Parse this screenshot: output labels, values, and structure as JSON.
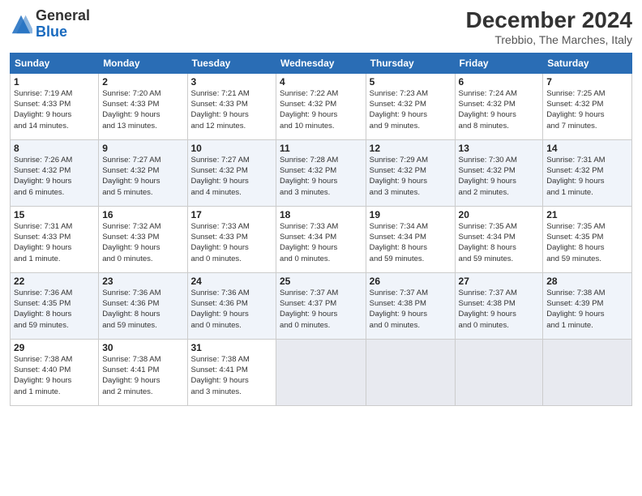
{
  "logo": {
    "general": "General",
    "blue": "Blue"
  },
  "title": "December 2024",
  "location": "Trebbio, The Marches, Italy",
  "headers": [
    "Sunday",
    "Monday",
    "Tuesday",
    "Wednesday",
    "Thursday",
    "Friday",
    "Saturday"
  ],
  "weeks": [
    [
      {
        "day": "1",
        "info": "Sunrise: 7:19 AM\nSunset: 4:33 PM\nDaylight: 9 hours\nand 14 minutes."
      },
      {
        "day": "2",
        "info": "Sunrise: 7:20 AM\nSunset: 4:33 PM\nDaylight: 9 hours\nand 13 minutes."
      },
      {
        "day": "3",
        "info": "Sunrise: 7:21 AM\nSunset: 4:33 PM\nDaylight: 9 hours\nand 12 minutes."
      },
      {
        "day": "4",
        "info": "Sunrise: 7:22 AM\nSunset: 4:32 PM\nDaylight: 9 hours\nand 10 minutes."
      },
      {
        "day": "5",
        "info": "Sunrise: 7:23 AM\nSunset: 4:32 PM\nDaylight: 9 hours\nand 9 minutes."
      },
      {
        "day": "6",
        "info": "Sunrise: 7:24 AM\nSunset: 4:32 PM\nDaylight: 9 hours\nand 8 minutes."
      },
      {
        "day": "7",
        "info": "Sunrise: 7:25 AM\nSunset: 4:32 PM\nDaylight: 9 hours\nand 7 minutes."
      }
    ],
    [
      {
        "day": "8",
        "info": "Sunrise: 7:26 AM\nSunset: 4:32 PM\nDaylight: 9 hours\nand 6 minutes."
      },
      {
        "day": "9",
        "info": "Sunrise: 7:27 AM\nSunset: 4:32 PM\nDaylight: 9 hours\nand 5 minutes."
      },
      {
        "day": "10",
        "info": "Sunrise: 7:27 AM\nSunset: 4:32 PM\nDaylight: 9 hours\nand 4 minutes."
      },
      {
        "day": "11",
        "info": "Sunrise: 7:28 AM\nSunset: 4:32 PM\nDaylight: 9 hours\nand 3 minutes."
      },
      {
        "day": "12",
        "info": "Sunrise: 7:29 AM\nSunset: 4:32 PM\nDaylight: 9 hours\nand 3 minutes."
      },
      {
        "day": "13",
        "info": "Sunrise: 7:30 AM\nSunset: 4:32 PM\nDaylight: 9 hours\nand 2 minutes."
      },
      {
        "day": "14",
        "info": "Sunrise: 7:31 AM\nSunset: 4:32 PM\nDaylight: 9 hours\nand 1 minute."
      }
    ],
    [
      {
        "day": "15",
        "info": "Sunrise: 7:31 AM\nSunset: 4:33 PM\nDaylight: 9 hours\nand 1 minute."
      },
      {
        "day": "16",
        "info": "Sunrise: 7:32 AM\nSunset: 4:33 PM\nDaylight: 9 hours\nand 0 minutes."
      },
      {
        "day": "17",
        "info": "Sunrise: 7:33 AM\nSunset: 4:33 PM\nDaylight: 9 hours\nand 0 minutes."
      },
      {
        "day": "18",
        "info": "Sunrise: 7:33 AM\nSunset: 4:34 PM\nDaylight: 9 hours\nand 0 minutes."
      },
      {
        "day": "19",
        "info": "Sunrise: 7:34 AM\nSunset: 4:34 PM\nDaylight: 8 hours\nand 59 minutes."
      },
      {
        "day": "20",
        "info": "Sunrise: 7:35 AM\nSunset: 4:34 PM\nDaylight: 8 hours\nand 59 minutes."
      },
      {
        "day": "21",
        "info": "Sunrise: 7:35 AM\nSunset: 4:35 PM\nDaylight: 8 hours\nand 59 minutes."
      }
    ],
    [
      {
        "day": "22",
        "info": "Sunrise: 7:36 AM\nSunset: 4:35 PM\nDaylight: 8 hours\nand 59 minutes."
      },
      {
        "day": "23",
        "info": "Sunrise: 7:36 AM\nSunset: 4:36 PM\nDaylight: 8 hours\nand 59 minutes."
      },
      {
        "day": "24",
        "info": "Sunrise: 7:36 AM\nSunset: 4:36 PM\nDaylight: 9 hours\nand 0 minutes."
      },
      {
        "day": "25",
        "info": "Sunrise: 7:37 AM\nSunset: 4:37 PM\nDaylight: 9 hours\nand 0 minutes."
      },
      {
        "day": "26",
        "info": "Sunrise: 7:37 AM\nSunset: 4:38 PM\nDaylight: 9 hours\nand 0 minutes."
      },
      {
        "day": "27",
        "info": "Sunrise: 7:37 AM\nSunset: 4:38 PM\nDaylight: 9 hours\nand 0 minutes."
      },
      {
        "day": "28",
        "info": "Sunrise: 7:38 AM\nSunset: 4:39 PM\nDaylight: 9 hours\nand 1 minute."
      }
    ],
    [
      {
        "day": "29",
        "info": "Sunrise: 7:38 AM\nSunset: 4:40 PM\nDaylight: 9 hours\nand 1 minute."
      },
      {
        "day": "30",
        "info": "Sunrise: 7:38 AM\nSunset: 4:41 PM\nDaylight: 9 hours\nand 2 minutes."
      },
      {
        "day": "31",
        "info": "Sunrise: 7:38 AM\nSunset: 4:41 PM\nDaylight: 9 hours\nand 3 minutes."
      },
      null,
      null,
      null,
      null
    ]
  ]
}
